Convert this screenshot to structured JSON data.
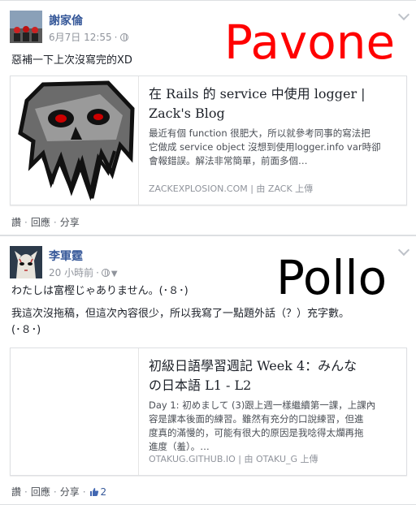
{
  "posts": [
    {
      "author": "謝家倫",
      "time": "6月7日 12:55",
      "message": "惡補一下上次沒寫完的XD",
      "overlay": "Pavone",
      "card": {
        "title_line1": "在 Rails 的 service 中使用 logger |",
        "title_line2": "Zack's Blog",
        "desc_line1": "最近有個 function 很肥大，所以就參考同事的寫法把",
        "desc_line2": "它做成 service object 沒想到使用logger.info var時卻",
        "desc_line3": "會報錯誤。解法非常簡單，前面多個…",
        "source": "ZACKEXPLOSION.COM | 由 ZACK 上傳"
      },
      "actions": {
        "like": "讚",
        "comment": "回應",
        "share": "分享"
      }
    },
    {
      "author": "李軍霆",
      "time": "20 小時前",
      "message_line1": "わたしは富樫じゃありません。(･８･)",
      "message_line2": "我這次沒拖稿，但這次內容很少，所以我寫了一點題外話（？）充字數。",
      "message_line3": "(･８･)",
      "overlay": "Pollo",
      "card": {
        "title_line1": "初級日語學習週記 Week 4：みんな",
        "title_line2": "の日本語 L1 - L2",
        "desc_line1": "Day 1: 初めまして (3)跟上週一樣繼續第一課，上課內",
        "desc_line2": "容是課本後面的練習。雖然有充分的口說練習，但進",
        "desc_line3": "度真的滿慢的，可能有很大的原因是我唸得太爛再拖",
        "desc_line4": "進度（羞）。…",
        "source": "OTAKUG.GITHUB.IO | 由 OTAKU_G 上傳"
      },
      "actions": {
        "like": "讚",
        "comment": "回應",
        "share": "分享",
        "like_count": "2"
      }
    }
  ],
  "colors": {
    "overlay1": "#ff0000",
    "overlay2": "#000000",
    "link": "#365899",
    "meta": "#90949c"
  }
}
